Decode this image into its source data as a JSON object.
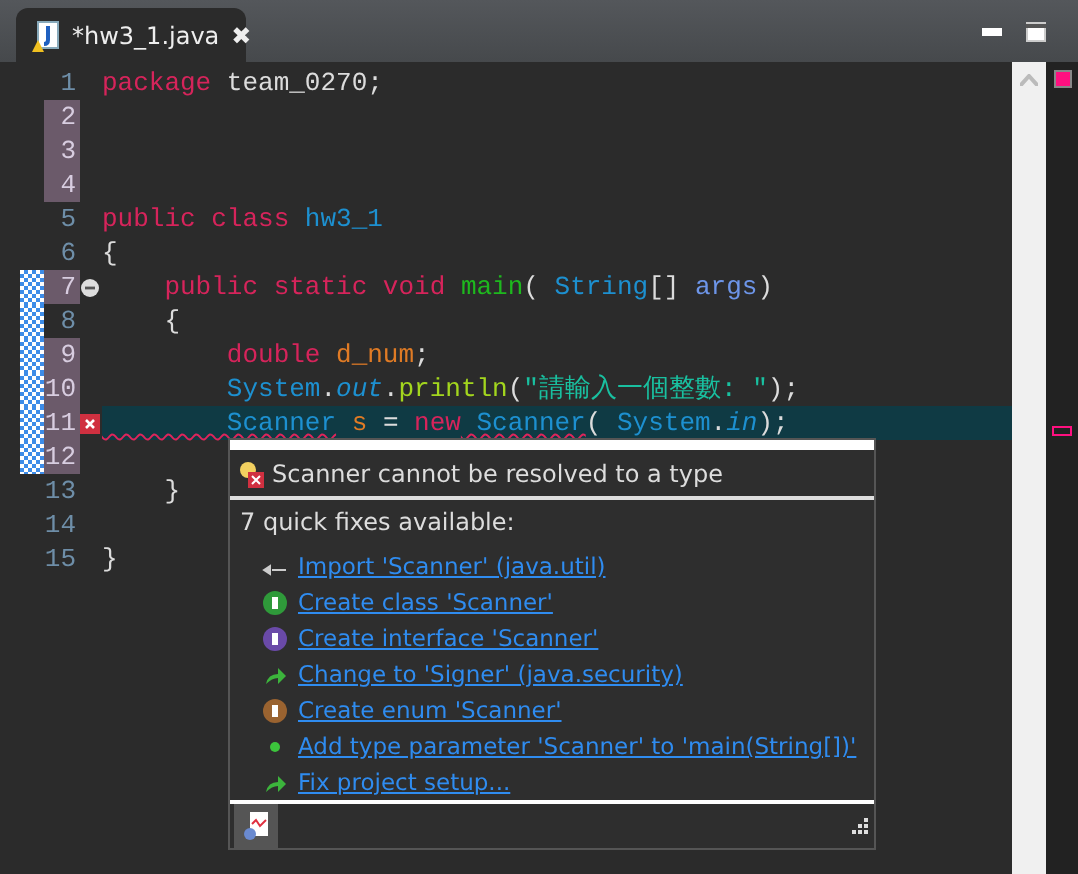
{
  "tab": {
    "title": "*hw3_1.java",
    "close": "✖"
  },
  "lines": [
    {
      "number": "1",
      "changed": false,
      "bar": false,
      "current": false,
      "error": false,
      "fold": false,
      "tokens": [
        {
          "text": "package",
          "kind": "keyword"
        },
        {
          "text": " team_0270;",
          "kind": "plain"
        }
      ]
    },
    {
      "number": "2",
      "changed": true,
      "bar": false,
      "current": false,
      "error": false,
      "fold": false
    },
    {
      "number": "3",
      "changed": true,
      "bar": false,
      "current": false,
      "error": false,
      "fold": false
    },
    {
      "number": "4",
      "changed": true,
      "bar": false,
      "current": false,
      "error": false,
      "fold": false
    },
    {
      "number": "5",
      "changed": false,
      "bar": false,
      "current": false,
      "error": false,
      "fold": false,
      "tokens": [
        {
          "text": "public class",
          "kind": "keyword"
        },
        {
          "text": " hw3_1",
          "kind": "type"
        }
      ]
    },
    {
      "number": "6",
      "changed": false,
      "bar": false,
      "current": false,
      "error": false,
      "fold": false,
      "tokens": [
        {
          "text": "{",
          "kind": "plain"
        }
      ]
    },
    {
      "number": "7",
      "changed": true,
      "bar": true,
      "current": false,
      "error": false,
      "fold": true,
      "tokens": [
        {
          "text": "    public static void",
          "kind": "keyword"
        },
        {
          "text": " main",
          "kind": "method"
        },
        {
          "text": "( ",
          "kind": "plain"
        },
        {
          "text": "String",
          "kind": "type"
        },
        {
          "text": "[] ",
          "kind": "plain"
        },
        {
          "text": "args",
          "kind": "param"
        },
        {
          "text": ")",
          "kind": "plain"
        }
      ]
    },
    {
      "number": "8",
      "changed": false,
      "bar": true,
      "current": false,
      "error": false,
      "fold": false,
      "tokens": [
        {
          "text": "    {",
          "kind": "plain"
        }
      ]
    },
    {
      "number": "9",
      "changed": true,
      "bar": true,
      "current": false,
      "error": false,
      "fold": false,
      "tokens": [
        {
          "text": "        double",
          "kind": "keyword"
        },
        {
          "text": " d_num",
          "kind": "variable"
        },
        {
          "text": ";",
          "kind": "plain"
        }
      ]
    },
    {
      "number": "10",
      "changed": true,
      "bar": true,
      "current": false,
      "error": false,
      "fold": false,
      "tokens": [
        {
          "text": "        System",
          "kind": "type"
        },
        {
          "text": ".",
          "kind": "plain"
        },
        {
          "text": "out",
          "kind": "field"
        },
        {
          "text": ".",
          "kind": "plain"
        },
        {
          "text": "println",
          "kind": "call"
        },
        {
          "text": "(",
          "kind": "plain"
        },
        {
          "text": "\"請輸入一個整數: \"",
          "kind": "string"
        },
        {
          "text": ");",
          "kind": "plain"
        }
      ]
    },
    {
      "number": "11",
      "changed": true,
      "bar": true,
      "current": true,
      "error": true,
      "fold": false,
      "tokens": [
        {
          "text": "        Scanner",
          "kind": "error"
        },
        {
          "text": " s",
          "kind": "variable"
        },
        {
          "text": " = ",
          "kind": "plain"
        },
        {
          "text": "new",
          "kind": "keyword"
        },
        {
          "text": " Scanner",
          "kind": "error"
        },
        {
          "text": "( ",
          "kind": "plain"
        },
        {
          "text": "System",
          "kind": "type"
        },
        {
          "text": ".",
          "kind": "plain"
        },
        {
          "text": "in",
          "kind": "field"
        },
        {
          "text": ");",
          "kind": "plain"
        }
      ]
    },
    {
      "number": "12",
      "changed": true,
      "bar": true,
      "current": false,
      "error": false,
      "fold": false
    },
    {
      "number": "13",
      "changed": false,
      "bar": false,
      "current": false,
      "error": false,
      "fold": false,
      "tokens": [
        {
          "text": "    }",
          "kind": "plain"
        }
      ]
    },
    {
      "number": "14",
      "changed": false,
      "bar": false,
      "current": false,
      "error": false,
      "fold": false
    },
    {
      "number": "15",
      "changed": false,
      "bar": false,
      "current": false,
      "error": false,
      "fold": false,
      "tokens": [
        {
          "text": "}",
          "kind": "plain"
        }
      ]
    }
  ],
  "popup": {
    "message": "Scanner cannot be resolved to a type",
    "count": "7 quick fixes available:",
    "fixes": [
      {
        "label": "Import 'Scanner' (java.util)",
        "kind": "import"
      },
      {
        "label": "Create class 'Scanner'",
        "kind": "class"
      },
      {
        "label": "Create interface 'Scanner'",
        "kind": "interface"
      },
      {
        "label": "Change to 'Signer' (java.security)",
        "kind": "change"
      },
      {
        "label": "Create enum 'Scanner'",
        "kind": "enum"
      },
      {
        "label": "Add type parameter 'Scanner' to 'main(String[])'",
        "kind": "dot"
      },
      {
        "label": "Fix project setup...",
        "kind": "change"
      }
    ]
  }
}
